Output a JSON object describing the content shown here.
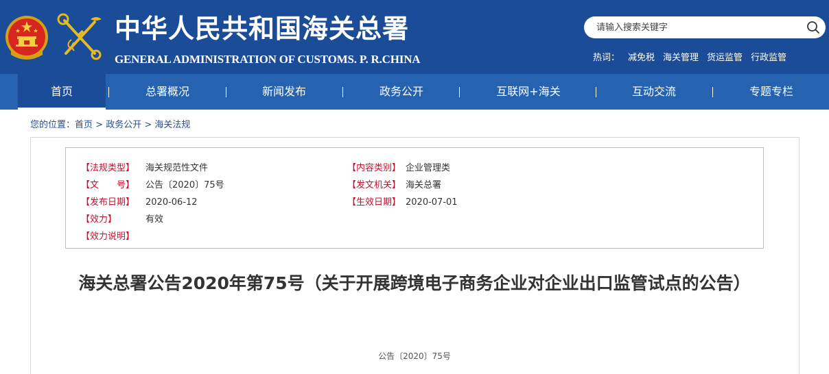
{
  "header": {
    "title": "中华人民共和国海关总署",
    "subtitle": "GENERAL ADMINISTRATION OF CUSTOMS. P. R.CHINA",
    "search_placeholder": "请输入搜索关键字",
    "hotwords_label": "热词：",
    "hotwords": [
      "减免税",
      "海关管理",
      "货运监管",
      "行政监管"
    ]
  },
  "nav": {
    "items": [
      "首页",
      "总署概况",
      "新闻发布",
      "政务公开",
      "互联网+海关",
      "互动交流",
      "专题专栏"
    ],
    "active": "首页"
  },
  "breadcrumb": {
    "prefix": "您的位置：",
    "items": [
      "首页",
      "政务公开",
      "海关法规"
    ],
    "separator": ">"
  },
  "meta": {
    "law_type_label": "【法规类型】",
    "law_type": "海关规范性文件",
    "content_type_label": "【内容类别】",
    "content_type": "企业管理类",
    "doc_no_label": "【文　　号】",
    "doc_no": "公告〔2020〕75号",
    "issuer_label": "【发文机关】",
    "issuer": "海关总署",
    "publish_date_label": "【发布日期】",
    "publish_date": "2020-06-12",
    "effective_date_label": "【生效日期】",
    "effective_date": "2020-07-01",
    "validity_label": "【效力】",
    "validity": "有效",
    "validity_note_label": "【效力说明】",
    "validity_note": ""
  },
  "article": {
    "title": "海关总署公告2020年第75号（关于开展跨境电子商务企业对企业出口监管试点的公告）",
    "doc_number": "公告〔2020〕75号"
  },
  "colors": {
    "header_bg": "#1b4c98",
    "nav_bg": "#2563b0",
    "label_red": "#c8102e"
  }
}
